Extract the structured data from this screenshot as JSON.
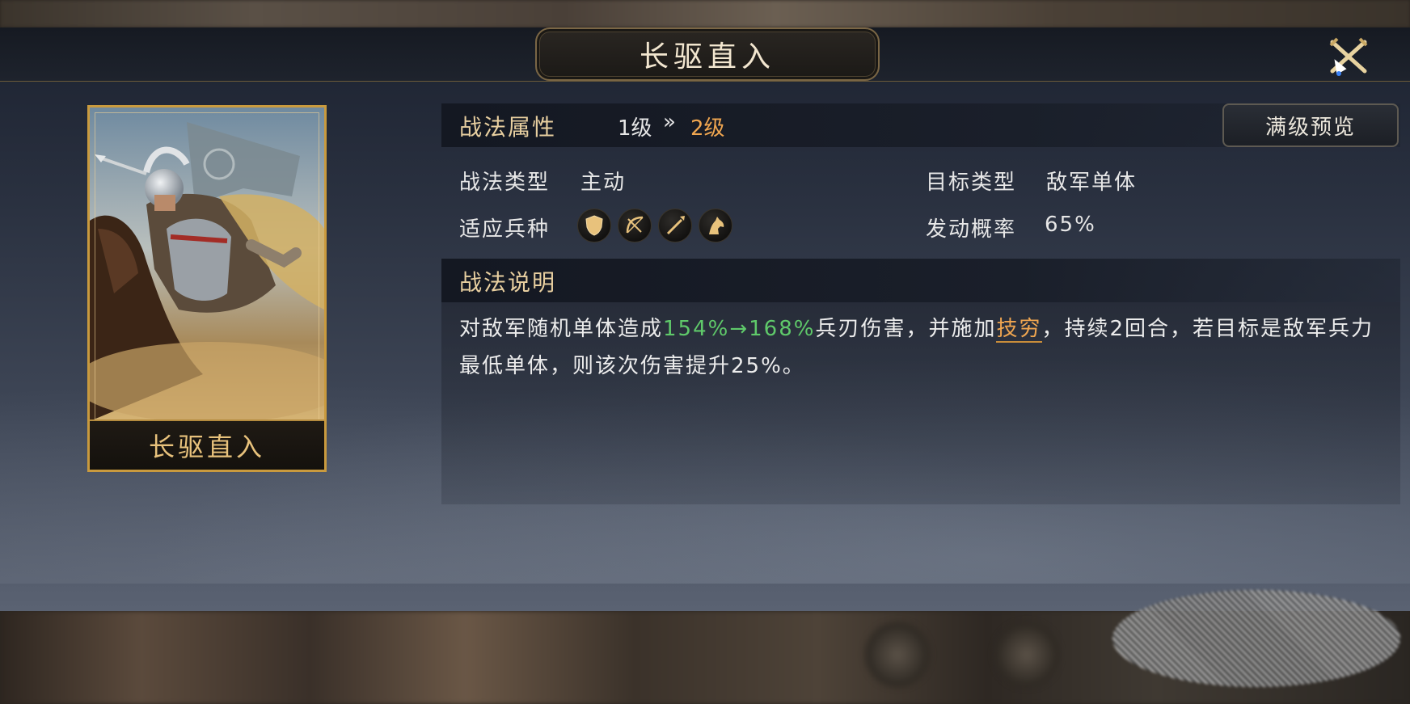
{
  "header": {
    "title": "长驱直入",
    "close_icon": "crossed-swords-close-icon"
  },
  "card": {
    "name": "长驱直入",
    "art": "armored-cavalry-general-portrait"
  },
  "attributes": {
    "section_title": "战法属性",
    "level_from": "1级",
    "level_arrow": "»",
    "level_to": "2级",
    "max_level_button": "满级预览",
    "tactic_type_label": "战法类型",
    "tactic_type_value": "主动",
    "target_type_label": "目标类型",
    "target_type_value": "敌军单体",
    "troops_label": "适应兵种",
    "troop_icons": [
      "shield-icon",
      "bow-icon",
      "spear-icon",
      "horse-icon"
    ],
    "trigger_rate_label": "发动概率",
    "trigger_rate_value": "65%"
  },
  "description": {
    "section_title": "战法说明",
    "part1": "对敌军随机单体造成",
    "damage_values": "154%→168%",
    "part2": "兵刃伤害，并施加",
    "status_keyword": "技穷",
    "part3": "，持续2回合，若目标是敌军兵力最低单体，则该次伤害提升25%。"
  },
  "colors": {
    "accent_gold": "#e8cfa0",
    "level_orange": "#f0a650",
    "damage_green": "#5fc96a"
  }
}
